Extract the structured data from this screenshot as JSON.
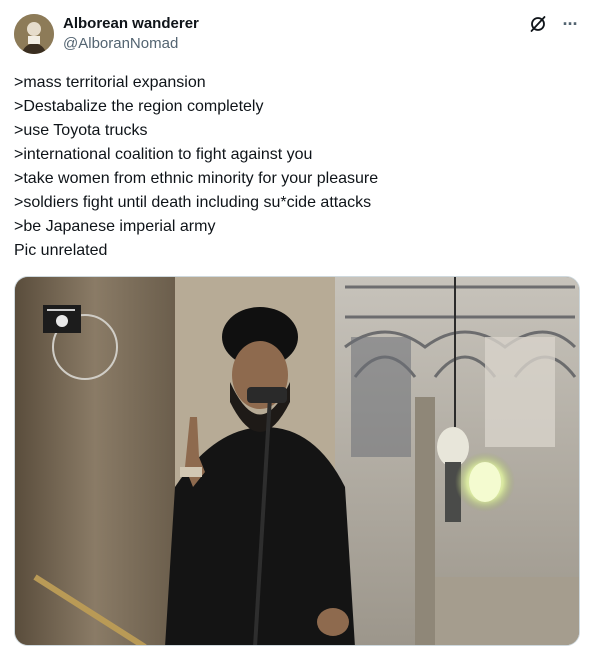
{
  "author": {
    "display_name": "Alborean wanderer",
    "handle": "@AlboranNomad",
    "avatar_icon": "avatar-portrait"
  },
  "actions": {
    "grok_icon": "slashed-circle-icon",
    "more_icon": "more-dots-icon",
    "more_glyph": "···"
  },
  "tweet": {
    "lines": [
      ">mass territorial expansion",
      ">Destabalize the region completely",
      ">use Toyota trucks",
      ">international coalition to fight against you",
      ">take women from ethnic minority for your pleasure",
      ">soldiers fight until death including su*cide attacks",
      ">be Japanese imperial army",
      "Pic unrelated"
    ]
  },
  "media": {
    "kind": "photo",
    "description_icon": "photo-speaker-mosque"
  },
  "colors": {
    "text": "#0f1419",
    "secondary": "#536471",
    "border": "#cfd9de"
  }
}
